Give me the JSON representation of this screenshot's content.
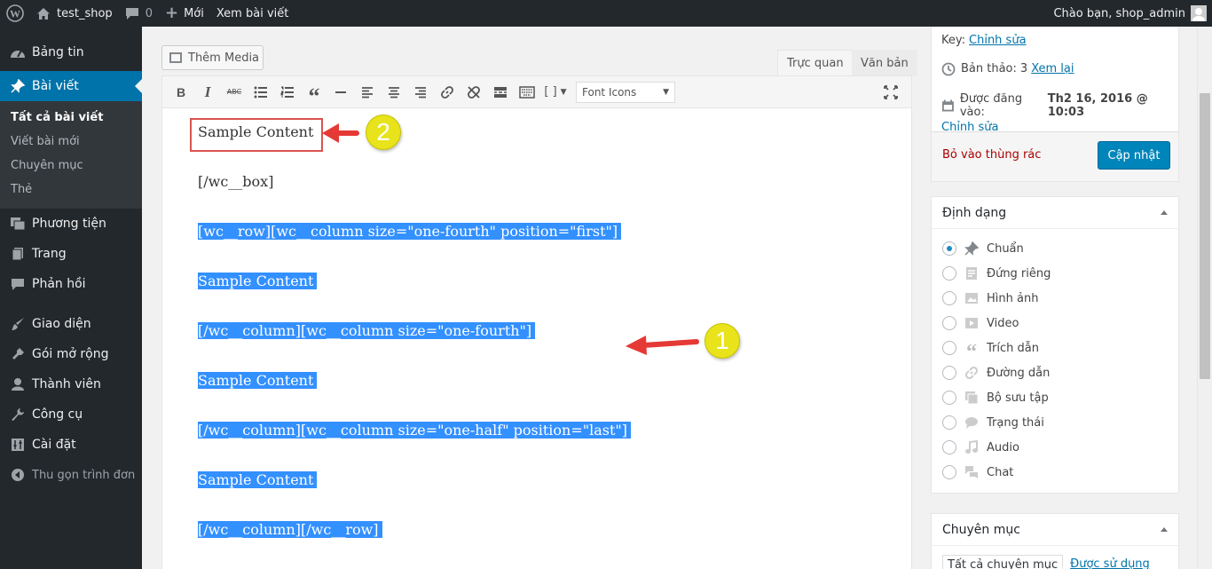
{
  "adminbar": {
    "site_name": "test_shop",
    "comments_count": "0",
    "new_label": "Mới",
    "view_post": "Xem bài viết",
    "greeting": "Chào bạn, shop_admin"
  },
  "sidebar": {
    "items": [
      {
        "label": "Bảng tin",
        "icon": "dashboard-icon"
      },
      {
        "label": "Bài viết",
        "icon": "pin-icon"
      },
      {
        "label": "Phương tiện",
        "icon": "media-icon"
      },
      {
        "label": "Trang",
        "icon": "page-icon"
      },
      {
        "label": "Phản hồi",
        "icon": "comment-icon"
      },
      {
        "label": "Giao diện",
        "icon": "brush-icon"
      },
      {
        "label": "Gói mở rộng",
        "icon": "plugin-icon"
      },
      {
        "label": "Thành viên",
        "icon": "user-icon"
      },
      {
        "label": "Công cụ",
        "icon": "wrench-icon"
      },
      {
        "label": "Cài đặt",
        "icon": "settings-icon"
      }
    ],
    "submenu": [
      "Tất cả bài viết",
      "Viết bài mới",
      "Chuyên mục",
      "Thẻ"
    ],
    "collapse": "Thu gọn trình đơn"
  },
  "editor": {
    "add_media": "Thêm Media",
    "tab_visual": "Trực quan",
    "tab_text": "Văn bản",
    "font_select": "Font Icons",
    "bracket_btn": "[ ]",
    "content": [
      "Sample Content",
      "[/wc__box]",
      "[wc__row][wc__column size=\"one-fourth\" position=\"first\"]",
      "Sample Content",
      "[/wc__column][wc__column size=\"one-fourth\"]",
      "Sample Content",
      "[/wc__column][wc__column size=\"one-half\" position=\"last\"]",
      "Sample Content",
      "[/wc__column][/wc__row]"
    ]
  },
  "annotations": {
    "one": "1",
    "two": "2"
  },
  "publish": {
    "key_label": "Key:",
    "edit_link": "Chỉnh sửa",
    "revisions_label": "Bản thảo:",
    "revisions_count": "3",
    "revisions_link": "Xem lại",
    "published_label": "Được đăng vào:",
    "published_date": "Th2 16, 2016 @ 10:03",
    "published_edit": "Chỉnh sửa",
    "trash": "Bỏ vào thùng rác",
    "update": "Cập nhật"
  },
  "format": {
    "title": "Định dạng",
    "options": [
      "Chuẩn",
      "Đứng riêng",
      "Hình ảnh",
      "Video",
      "Trích dẫn",
      "Đường dẫn",
      "Bộ sưu tập",
      "Trạng thái",
      "Audio",
      "Chat"
    ],
    "selected": "Chuẩn"
  },
  "categories": {
    "title": "Chuyên mục",
    "tab_all": "Tất cả chuyên mục",
    "tab_popular": "Được sử dụng"
  },
  "colors": {
    "accent": "#0073aa",
    "adminbar": "#23282d",
    "selection": "#3390ff",
    "annotation": "#e8e31b",
    "arrow": "#e53935"
  }
}
